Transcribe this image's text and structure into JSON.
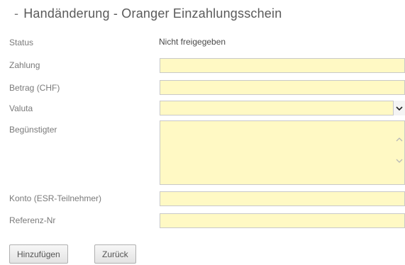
{
  "page": {
    "title": "Handänderung - Oranger Einzahlungsschein",
    "title_prefix": "-"
  },
  "form": {
    "status_label": "Status",
    "status_value": "Nicht freigegeben",
    "zahlung_label": "Zahlung",
    "zahlung_value": "",
    "betrag_label": "Betrag (CHF)",
    "betrag_value": "",
    "valuta_label": "Valuta",
    "valuta_value": "",
    "beguenstigter_label": "Begünstigter",
    "beguenstigter_value": "",
    "konto_label": "Konto (ESR-Teilnehmer)",
    "konto_value": "",
    "referenz_label": "Referenz-Nr",
    "referenz_value": ""
  },
  "buttons": {
    "add_label": "Hinzufügen",
    "back_label": "Zurück"
  },
  "colors": {
    "field_background": "#fff9c4",
    "field_border": "#c9c9c9"
  },
  "icons": {
    "select_arrow": "chevron-down-icon",
    "scroll_up": "chevron-up-icon",
    "scroll_down": "chevron-down-icon"
  }
}
